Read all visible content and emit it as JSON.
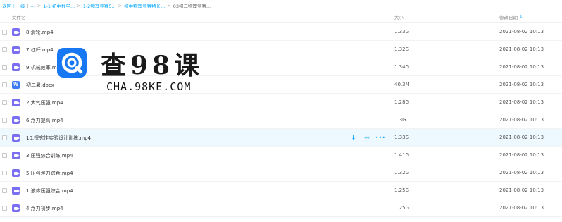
{
  "breadcrumb": [
    {
      "label": "返回上一级"
    },
    {
      "label": "..."
    },
    {
      "label": "1-1 初中数学..."
    },
    {
      "label": "1-2物理竞赛5..."
    },
    {
      "label": "初中物理竞赛特长..."
    },
    {
      "label": "03初二物理竞赛..."
    }
  ],
  "columns": {
    "name": "文件名",
    "size": "大小",
    "date": "修改日期"
  },
  "sort_icon": "arrow-down-icon",
  "files": [
    {
      "name": "8.滑轮.mp4",
      "size": "1.33G",
      "date": "2021-08-02 10:13",
      "type": "video"
    },
    {
      "name": "7.杠杆.mp4",
      "size": "1.32G",
      "date": "2021-08-02 10:13",
      "type": "video"
    },
    {
      "name": "9.机械效率.mp4",
      "size": "1.34G",
      "date": "2021-08-02 10:13",
      "type": "video"
    },
    {
      "name": "初二暑.docx",
      "size": "40.3M",
      "date": "2021-08-02 10:13",
      "type": "doc"
    },
    {
      "name": "2.大气压强.mp4",
      "size": "1.28G",
      "date": "2021-08-02 10:13",
      "type": "video"
    },
    {
      "name": "6.浮力提高.mp4",
      "size": "1.3G",
      "date": "2021-08-02 10:13",
      "type": "video"
    },
    {
      "name": "10.探究性实验设计训练.mp4",
      "size": "1.33G",
      "date": "2021-08-02 10:13",
      "type": "video"
    },
    {
      "name": "3.压强综合训练.mp4",
      "size": "1.41G",
      "date": "2021-08-02 10:13",
      "type": "video"
    },
    {
      "name": "5.压强浮力综合.mp4",
      "size": "1.32G",
      "date": "2021-08-02 10:13",
      "type": "video"
    },
    {
      "name": "1.液体压强综合.mp4",
      "size": "1.25G",
      "date": "2021-08-02 10:13",
      "type": "video"
    },
    {
      "name": "4.浮力初步.mp4",
      "size": "1.25G",
      "date": "2021-08-02 10:13",
      "type": "video"
    }
  ],
  "hover_row_index": 6,
  "row_actions": [
    "download-icon",
    "share-icon",
    "more-icon"
  ],
  "doc_icon_letter": "W",
  "watermark": {
    "title": "查98课",
    "subtitle": "CHA.98KE.COM"
  },
  "colors": {
    "accent": "#06a7ff",
    "video_icon": "#7a6ff0",
    "doc_icon": "#3d7cf0",
    "logo": "#1877f2",
    "hover_row": "#eef8ff"
  }
}
